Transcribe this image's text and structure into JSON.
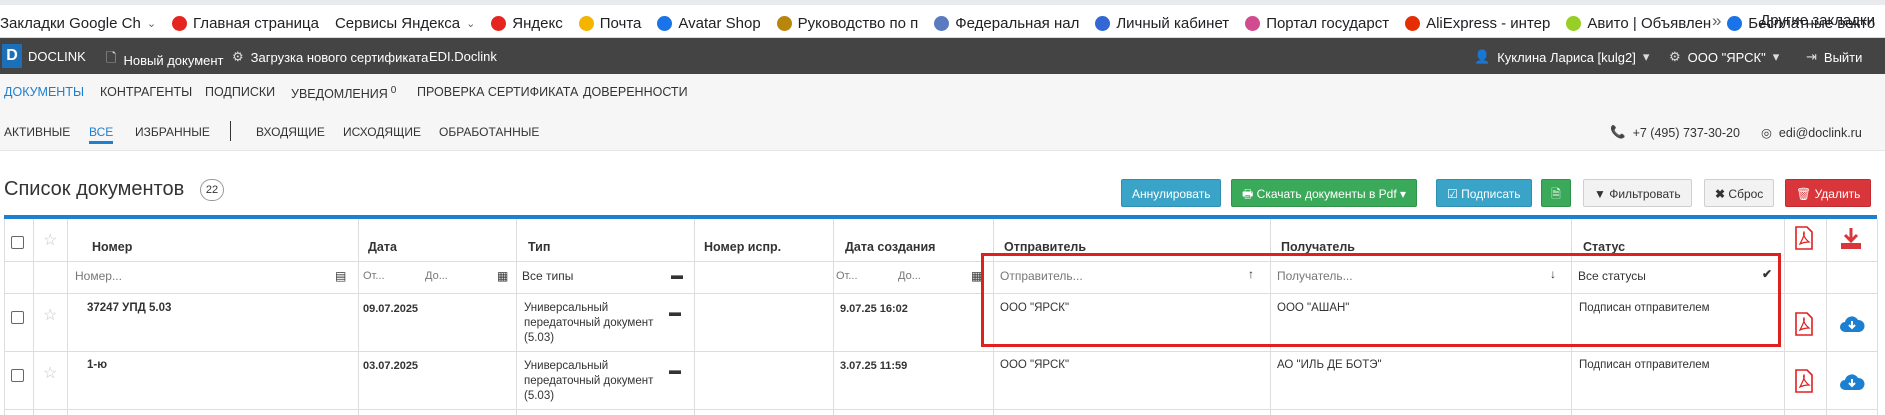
{
  "bookmarks": {
    "items": [
      {
        "label": "Закладки Google Ch",
        "chevron": true,
        "color": ""
      },
      {
        "label": "Главная страница",
        "chevron": false,
        "color": "#e52620"
      },
      {
        "label": "Сервисы Яндекса",
        "chevron": true,
        "color": ""
      },
      {
        "label": "Яндекс",
        "chevron": false,
        "color": "#e52620"
      },
      {
        "label": "Почта",
        "chevron": false,
        "color": "#f4b400"
      },
      {
        "label": "Avatar Shop",
        "chevron": false,
        "color": "#1a73e8"
      },
      {
        "label": "Руководство по п",
        "chevron": false,
        "color": "#b8860b"
      },
      {
        "label": "Федеральная нал",
        "chevron": false,
        "color": "#5a7bbf"
      },
      {
        "label": "Личный кабинет",
        "chevron": false,
        "color": "#3367d6"
      },
      {
        "label": "Портал государст",
        "chevron": false,
        "color": "#d14b8f"
      },
      {
        "label": "AliExpress - интер",
        "chevron": false,
        "color": "#e62e04"
      },
      {
        "label": "Авито | Объявлен",
        "chevron": false,
        "color": "#97cf26"
      },
      {
        "label": "Бесплатные векто",
        "chevron": false,
        "color": "#1a73e8"
      }
    ],
    "more": "»",
    "other": "Другие закладки"
  },
  "appbar": {
    "logo": "D",
    "brand": "DOCLINK",
    "new_doc": "Новый документ",
    "upload_cert": "Загрузка нового сертификата",
    "edi": "EDI.Doclink",
    "user": "Куклина Лариса [kulg2]",
    "org": "ООО \"ЯРСК\"",
    "logout": "Выйти"
  },
  "nav": {
    "tabs": [
      "ДОКУМЕНТЫ",
      "КОНТРАГЕНТЫ",
      "ПОДПИСКИ",
      "УВЕДОМЛЕНИЯ",
      "ПРОВЕРКА СЕРТИФИКАТА",
      "ДОВЕРЕННОСТИ"
    ],
    "notifications_count": "0"
  },
  "subnav": {
    "tabs": [
      "АКТИВНЫЕ",
      "ВСЕ",
      "ИЗБРАННЫЕ",
      "ВХОДЯЩИЕ",
      "ИСХОДЯЩИЕ",
      "ОБРАБОТАННЫЕ"
    ],
    "phone": "+7 (495) 737-30-20",
    "email": "edi@doclink.ru"
  },
  "page": {
    "title": "Список документов",
    "count": "22"
  },
  "toolbar": {
    "annul": "Аннулировать",
    "download_pdf": "Скачать документы в Pdf",
    "sign": "Подписать",
    "filter": "Фильтровать",
    "reset": "Сброс",
    "delete": "Удалить"
  },
  "table": {
    "headers": {
      "number": "Номер",
      "date": "Дата",
      "type": "Тип",
      "corr_number": "Номер испр.",
      "created": "Дата создания",
      "sender": "Отправитель",
      "receiver": "Получатель",
      "status": "Статус"
    },
    "filters": {
      "number": "Номер...",
      "date_from": "От...",
      "date_to": "До...",
      "type": "Все типы",
      "created_from": "От...",
      "created_to": "До...",
      "sender": "Отправитель...",
      "receiver": "Получатель...",
      "status": "Все статусы"
    },
    "rows": [
      {
        "number": "37247 УПД 5.03",
        "date": "09.07.2025",
        "type": "Универсальный передаточный документ (5.03)",
        "corr_number": "",
        "created": "9.07.25 16:02",
        "sender": "ООО \"ЯРСК\"",
        "receiver": "ООО \"АШАН\"",
        "status": "Подписан отправителем"
      },
      {
        "number": "1-ю",
        "date": "03.07.2025",
        "type": "Универсальный передаточный документ (5.03)",
        "corr_number": "",
        "created": "3.07.25 11:59",
        "sender": "ООО \"ЯРСК\"",
        "receiver": "АО \"ИЛЬ ДЕ БОТЭ\"",
        "status": "Подписан отправителем"
      }
    ]
  },
  "colors": {
    "accent": "#1d7fcf",
    "appbar": "#444444",
    "highlight": "#e01f1f",
    "pdf": "#e02020",
    "download": "#1d7fcf"
  }
}
